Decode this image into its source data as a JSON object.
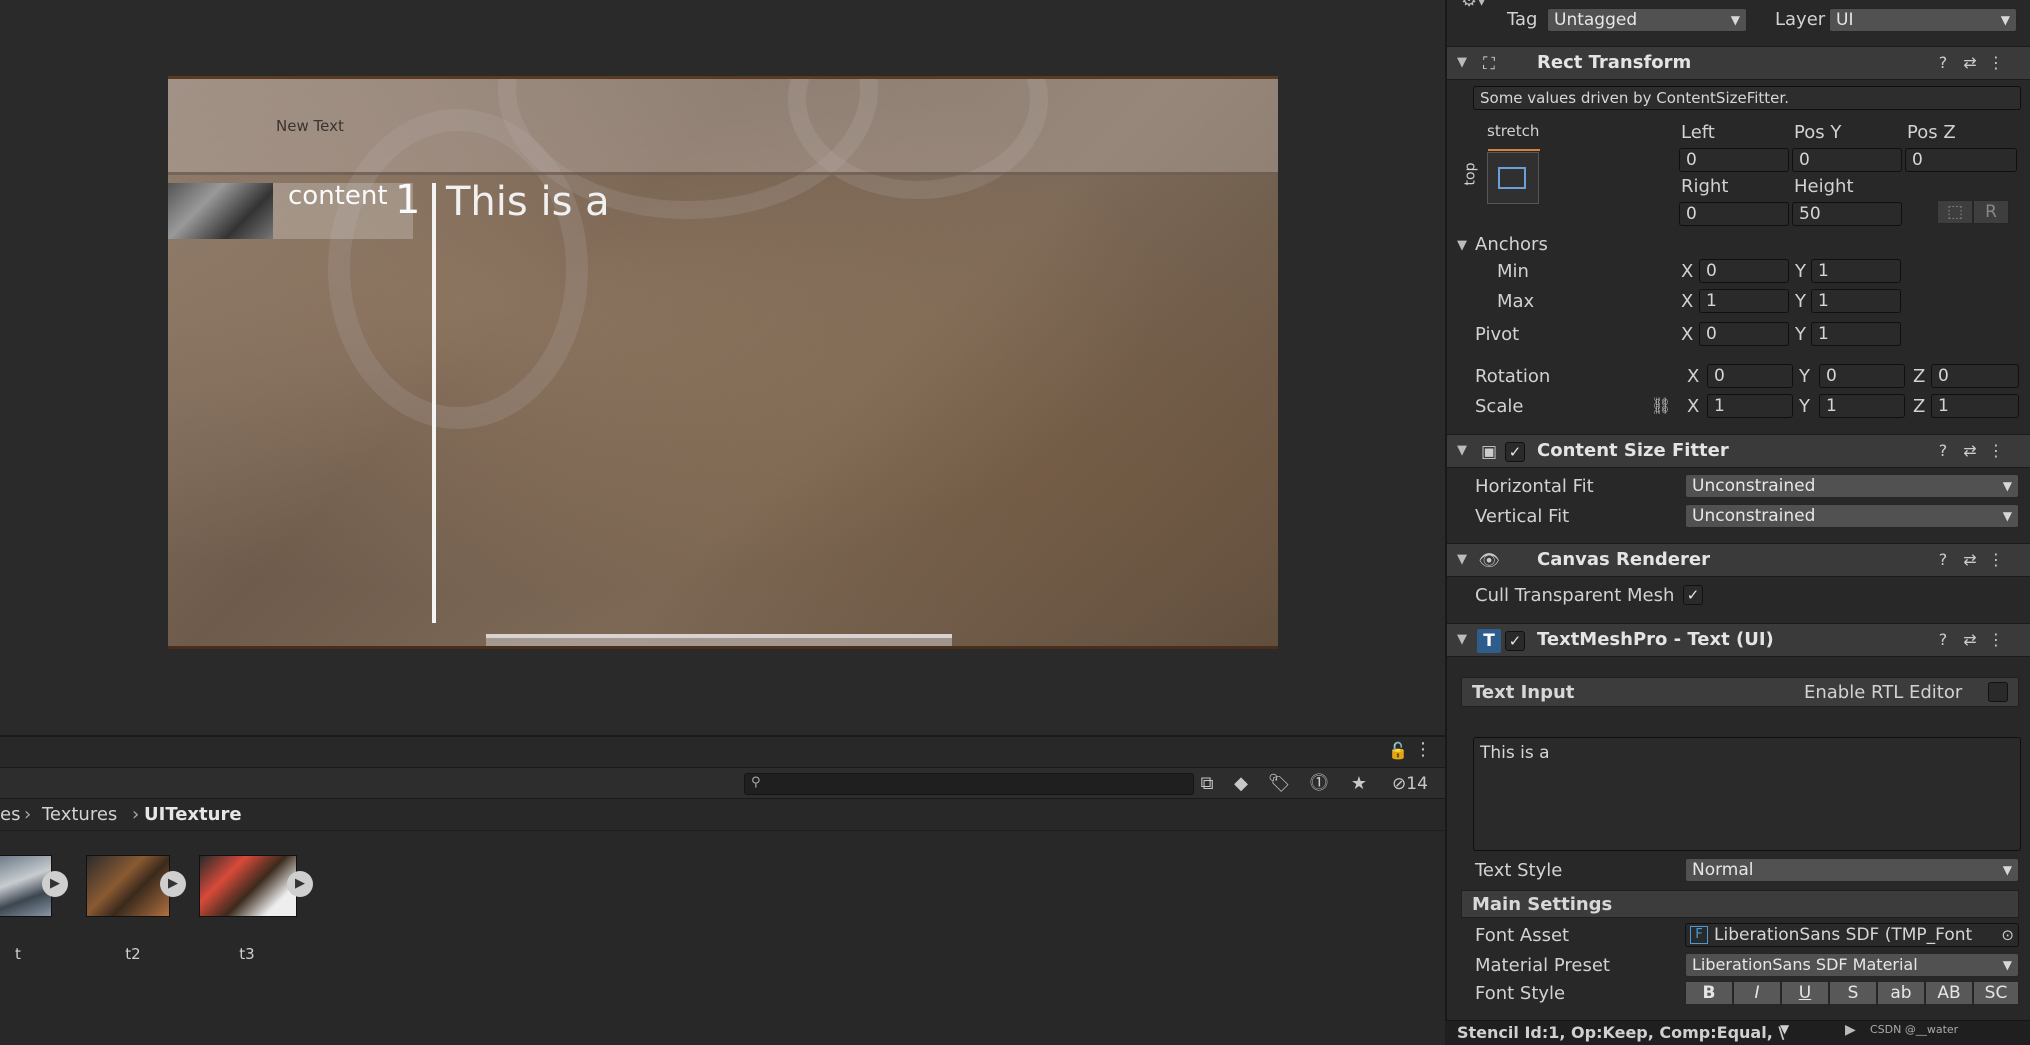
{
  "scene": {
    "new_text": "New Text",
    "content_label": "content",
    "content_number": "1",
    "big_text": "This is a"
  },
  "project": {
    "breadcrumb": [
      "es",
      "Textures",
      "UITexture"
    ],
    "hidden_count": "14",
    "assets": [
      {
        "label": "t"
      },
      {
        "label": "t2"
      },
      {
        "label": "t3"
      }
    ]
  },
  "inspector": {
    "tag_label": "Tag",
    "tag_value": "Untagged",
    "layer_label": "Layer",
    "layer_value": "UI",
    "rect_transform": {
      "title": "Rect Transform",
      "driven_note": "Some values driven by ContentSizeFitter.",
      "anchor_h": "stretch",
      "anchor_v": "top",
      "left_label": "Left",
      "left": "0",
      "posy_label": "Pos Y",
      "posy": "0",
      "posz_label": "Pos Z",
      "posz": "0",
      "right_label": "Right",
      "right": "0",
      "height_label": "Height",
      "height": "50",
      "r_button": "R",
      "anchors_label": "Anchors",
      "min_label": "Min",
      "min_x": "0",
      "min_y": "1",
      "max_label": "Max",
      "max_x": "1",
      "max_y": "1",
      "pivot_label": "Pivot",
      "pivot_x": "0",
      "pivot_y": "1",
      "rotation_label": "Rotation",
      "rot_x": "0",
      "rot_y": "0",
      "rot_z": "0",
      "scale_label": "Scale",
      "scale_x": "1",
      "scale_y": "1",
      "scale_z": "1",
      "x": "X",
      "y": "Y",
      "z": "Z"
    },
    "content_size_fitter": {
      "title": "Content Size Fitter",
      "horizontal_label": "Horizontal Fit",
      "horizontal_value": "Unconstrained",
      "vertical_label": "Vertical Fit",
      "vertical_value": "Unconstrained"
    },
    "canvas_renderer": {
      "title": "Canvas Renderer",
      "cull_label": "Cull Transparent Mesh"
    },
    "tmp": {
      "title": "TextMeshPro - Text (UI)",
      "text_input_label": "Text Input",
      "rtl_label": "Enable RTL Editor",
      "text_value": "This is a",
      "text_style_label": "Text Style",
      "text_style_value": "Normal",
      "main_settings_label": "Main Settings",
      "font_asset_label": "Font Asset",
      "font_asset_value": "LiberationSans SDF (TMP_Font",
      "material_label": "Material Preset",
      "material_value": "LiberationSans SDF Material",
      "font_style_label": "Font Style",
      "font_styles": [
        "B",
        "I",
        "U",
        "S",
        "ab",
        "AB",
        "SC"
      ]
    },
    "status": "Stencil Id:1, Op:Keep, Comp:Equal, \\",
    "watermark": "CSDN @__water"
  }
}
